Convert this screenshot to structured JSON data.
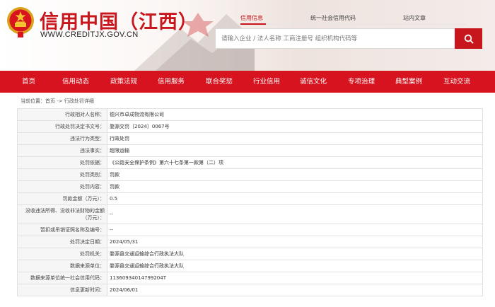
{
  "header": {
    "site_title": "信用中国（江西）",
    "site_url": "WWW.CREDITJX.GOV.CN",
    "top_links": [
      {
        "label": "信用信息",
        "active": true
      },
      {
        "label": "统一社会信用代码",
        "active": false
      },
      {
        "label": "站内文章",
        "active": false
      }
    ],
    "search_placeholder": "请输入企业 / 法人名称 工商注册号 组织机构代码等",
    "accent_color": "#c8161d"
  },
  "nav": {
    "items": [
      "首页",
      "信用动态",
      "政策法规",
      "信用服务",
      "联合奖惩",
      "行业信用",
      "诚信文化",
      "专项治理",
      "典型案例",
      "互动交流"
    ],
    "background": "#d6131e"
  },
  "breadcrumb": "当前位置：首页 -> 行政处罚详细",
  "detail": {
    "rows": [
      {
        "label": "行政相对人名称：",
        "value": "德兴市卓成物流有限公司"
      },
      {
        "label": "行政处罚决定书文号：",
        "value": "婺源交罚〔2024〕0067号"
      },
      {
        "label": "违法行为类型：",
        "value": "行政处罚"
      },
      {
        "label": "违法事实：",
        "value": "超限运输"
      },
      {
        "label": "处罚依据：",
        "value": "《公路安全保护条例》第六十七条第一款第（二）项"
      },
      {
        "label": "处罚类别：",
        "value": "罚款"
      },
      {
        "label": "处罚内容：",
        "value": "罚款"
      },
      {
        "label": "罚款金额（万元）：",
        "value": "0.5"
      },
      {
        "label": "没收违法所得、没收非法财物的金额（万元）：",
        "value": "--"
      },
      {
        "label": "暂扣或吊销证照名称及编号：",
        "value": "--"
      },
      {
        "label": "处罚决定日期：",
        "value": "2024/05/31"
      },
      {
        "label": "处罚机关：",
        "value": "婺源县交通运输综合行政执法大队"
      },
      {
        "label": "数据来源单位：",
        "value": "婺源县交通运输综合行政执法大队"
      },
      {
        "label": "数据来源单位统一社会信用代码：",
        "value": "11360934014799204T"
      },
      {
        "label": "信息更新时间：",
        "value": "2024/06/01"
      }
    ]
  }
}
